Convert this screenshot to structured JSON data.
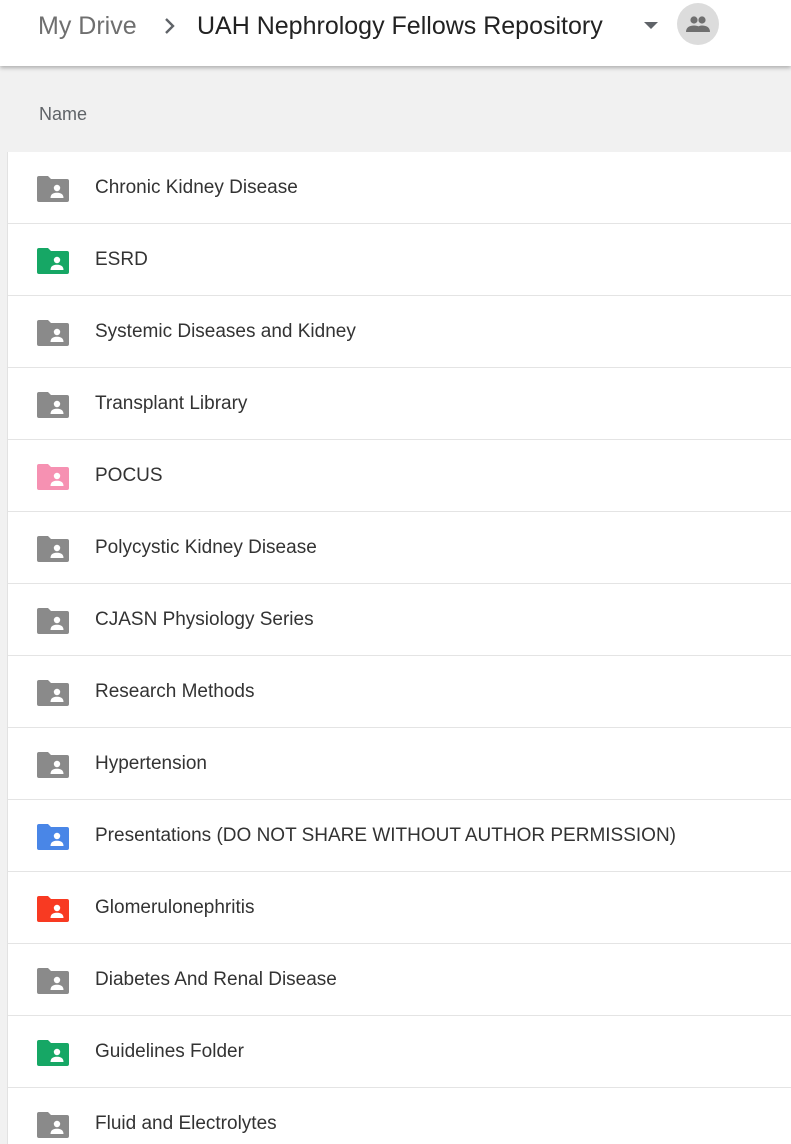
{
  "breadcrumb": {
    "root": "My Drive",
    "current": "UAH Nephrology Fellows Repository"
  },
  "icons": {
    "separator": "chevron-right-icon",
    "dropdown": "arrow-drop-down-icon",
    "shared": "people-icon",
    "folder": "shared-folder-icon"
  },
  "list": {
    "column_header": "Name",
    "items": [
      {
        "name": "Chronic Kidney Disease",
        "color": "#8a8a8a"
      },
      {
        "name": "ESRD",
        "color": "#16a765"
      },
      {
        "name": "Systemic Diseases and Kidney",
        "color": "#8a8a8a"
      },
      {
        "name": "Transplant Library",
        "color": "#8a8a8a"
      },
      {
        "name": "POCUS",
        "color": "#f691b2"
      },
      {
        "name": "Polycystic Kidney Disease",
        "color": "#8a8a8a"
      },
      {
        "name": "CJASN Physiology Series",
        "color": "#8a8a8a"
      },
      {
        "name": "Research Methods",
        "color": "#8a8a8a"
      },
      {
        "name": "Hypertension",
        "color": "#8a8a8a"
      },
      {
        "name": "Presentations (DO NOT SHARE WITHOUT AUTHOR PERMISSION)",
        "color": "#4986e7"
      },
      {
        "name": "Glomerulonephritis",
        "color": "#f83a22"
      },
      {
        "name": "Diabetes And Renal Disease",
        "color": "#8a8a8a"
      },
      {
        "name": "Guidelines Folder",
        "color": "#16a765"
      },
      {
        "name": "Fluid and Electrolytes",
        "color": "#8a8a8a"
      }
    ]
  }
}
